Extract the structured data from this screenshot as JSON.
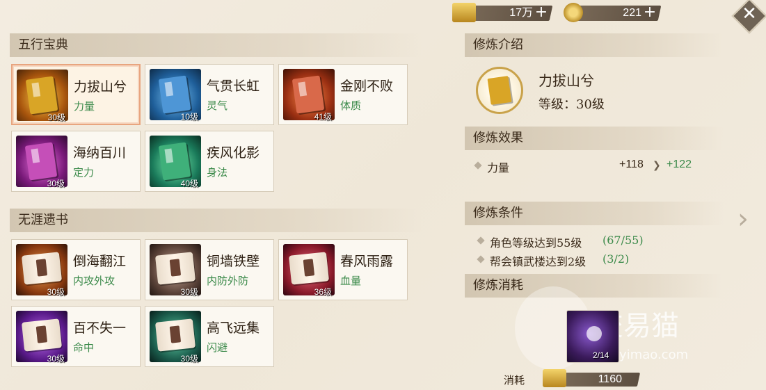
{
  "currency": {
    "gold": {
      "value": "17万",
      "icon": "gold-ingot-icon"
    },
    "coin": {
      "value": "221",
      "icon": "copper-coin-icon"
    },
    "plus": "+"
  },
  "close": {
    "symbol": "✕"
  },
  "sections": {
    "wuxing": "五行宝典",
    "wuya": "无涯遗书"
  },
  "wuxing_cards": [
    {
      "name": "力拔山兮",
      "attr": "力量",
      "level": "30级",
      "color": "#d9a526"
    },
    {
      "name": "气贯长虹",
      "attr": "灵气",
      "level": "10级",
      "color": "#4e96d6"
    },
    {
      "name": "金刚不败",
      "attr": "体质",
      "level": "41级",
      "color": "#d9694a"
    },
    {
      "name": "海纳百川",
      "attr": "定力",
      "level": "30级",
      "color": "#c54fb8"
    },
    {
      "name": "疾风化影",
      "attr": "身法",
      "level": "40级",
      "color": "#3fb07a"
    }
  ],
  "wuya_cards": [
    {
      "name": "倒海翻江",
      "attr": "内攻外攻",
      "level": "30级",
      "color": "#c56a2a"
    },
    {
      "name": "铜墙铁壁",
      "attr": "内防外防",
      "level": "30级",
      "color": "#8a6a5a"
    },
    {
      "name": "春风雨露",
      "attr": "血量",
      "level": "36级",
      "color": "#c23a52"
    },
    {
      "name": "百不失一",
      "attr": "命中",
      "level": "30级",
      "color": "#8a3ab8"
    },
    {
      "name": "高飞远集",
      "attr": "闪避",
      "level": "30级",
      "color": "#2e8a6a"
    }
  ],
  "intro": {
    "header": "修炼介绍",
    "name": "力拔山兮",
    "level": "等级：30级"
  },
  "effect": {
    "header": "修炼效果",
    "stat": "力量",
    "current": "+118",
    "next": "+122"
  },
  "conditions": {
    "header": "修炼条件",
    "items": [
      {
        "text": "角色等级达到55级",
        "progress": "(67/55)"
      },
      {
        "text": "帮会镇武楼达到2级",
        "progress": "(3/2)"
      }
    ]
  },
  "cost": {
    "header": "修炼消耗",
    "item_count": "2/14",
    "label": "消耗",
    "amount": "1160"
  },
  "watermark": {
    "text": "交易猫",
    "url": "jiaoyimao.com"
  }
}
